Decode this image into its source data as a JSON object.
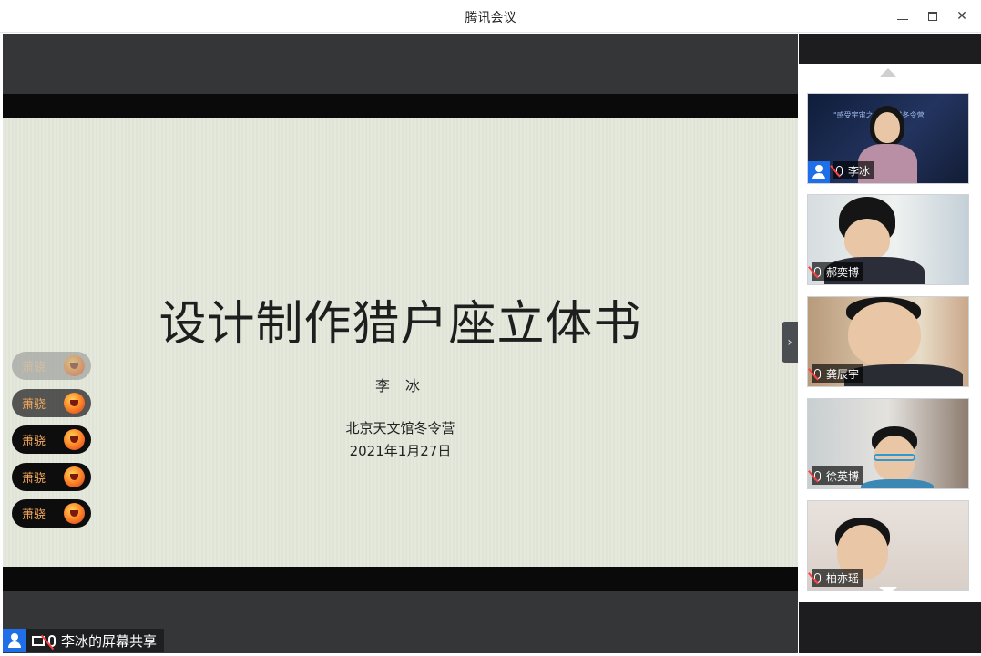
{
  "window": {
    "title": "腾讯会议",
    "controls": {
      "minimize": "minimize",
      "maximize": "maximize",
      "close": "close"
    }
  },
  "slide": {
    "title": "设计制作猎户座立体书",
    "author": "李 冰",
    "organization": "北京天文馆冬令营",
    "date": "2021年1月27日"
  },
  "reactions": [
    {
      "label": "萧骁"
    },
    {
      "label": "萧骁"
    },
    {
      "label": "萧骁"
    },
    {
      "label": "萧骁"
    },
    {
      "label": "萧骁"
    }
  ],
  "share_label": {
    "text": "李冰的屏幕共享"
  },
  "participants": [
    {
      "name": "李冰",
      "host": true,
      "caption": "\"感受宇宙之……科普冬令营"
    },
    {
      "name": "郝奕博",
      "host": false
    },
    {
      "name": "龚辰宇",
      "host": false
    },
    {
      "name": "徐英博",
      "host": false
    },
    {
      "name": "柏亦瑶",
      "host": false
    }
  ],
  "colors": {
    "accent_blue": "#1f6fe8",
    "reaction_text": "#f2a65a",
    "mic_muted": "#ff4040"
  },
  "icons": {
    "share_screen": "screen-share-icon",
    "muted_mic": "mic-muted-icon",
    "host": "user-icon",
    "scroll_up": "triangle-up-icon",
    "scroll_down": "triangle-down-icon",
    "collapse_panel": "chevron-right-icon"
  }
}
